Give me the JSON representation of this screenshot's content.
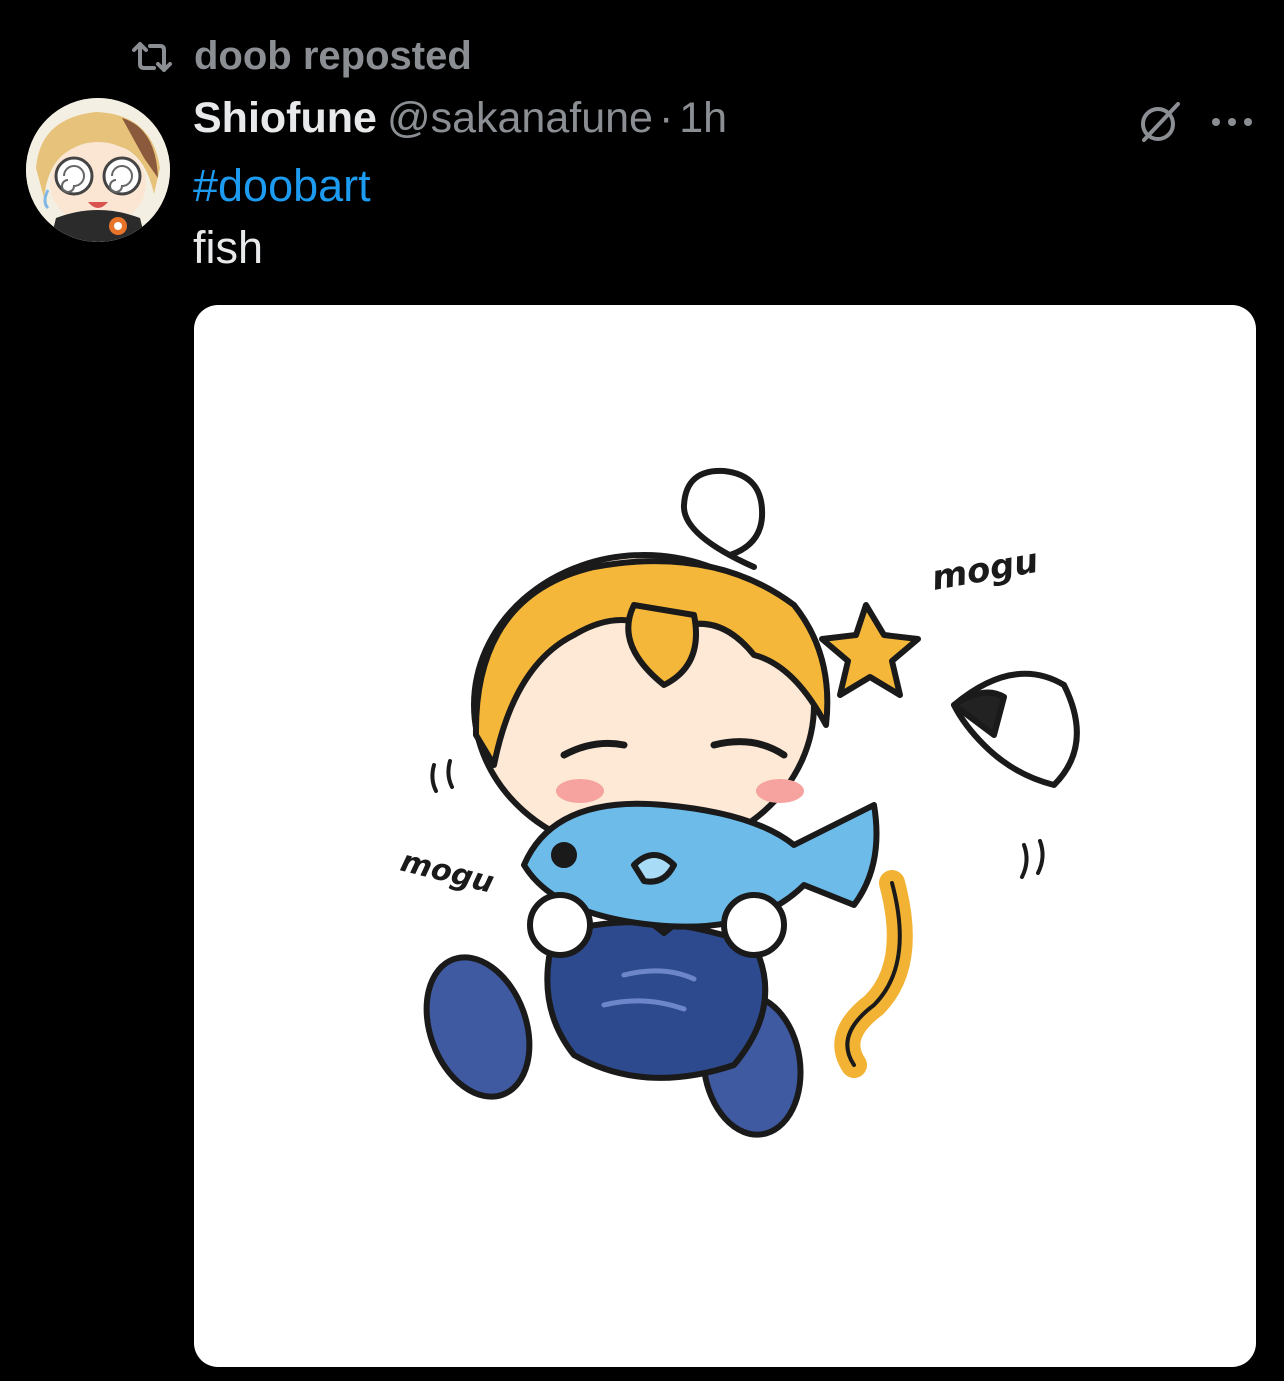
{
  "repost": {
    "icon": "repost-icon",
    "label": "doob reposted"
  },
  "author": {
    "display_name": "Shiofune",
    "handle": "@sakanafune",
    "separator": "·",
    "time": "1h"
  },
  "actions": {
    "grok_icon": "grok-icon",
    "more_icon": "more-icon"
  },
  "tweet": {
    "hashtag": "#doobart",
    "text": "fish"
  },
  "media": {
    "sfx_top": "mogu",
    "sfx_left": "mogu"
  },
  "colors": {
    "background": "#000000",
    "text_primary": "#e7e9ea",
    "text_secondary": "#8b8f94",
    "link": "#1d9bf0",
    "media_bg": "#ffffff"
  }
}
